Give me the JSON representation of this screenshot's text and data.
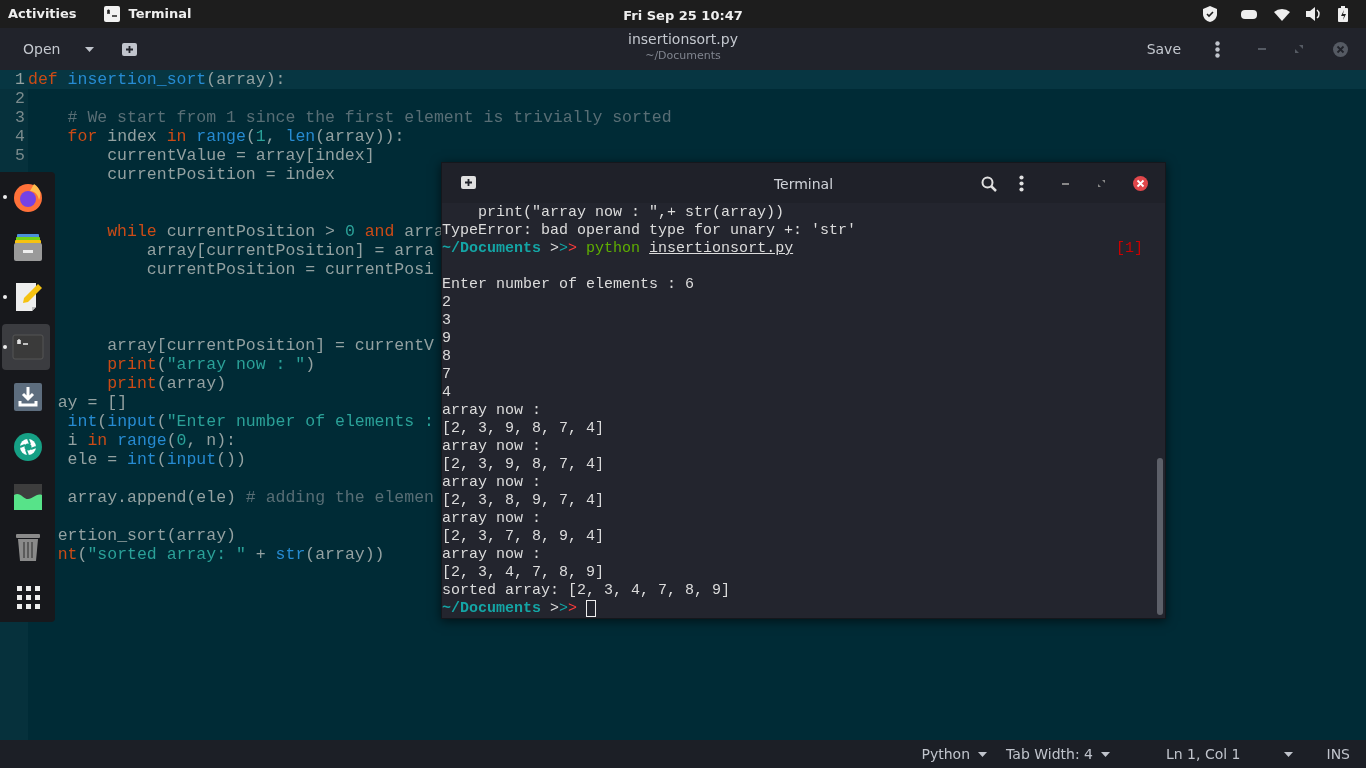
{
  "top_bar": {
    "activities": "Activities",
    "app_name": "Terminal",
    "clock": "Fri Sep 25  10:47"
  },
  "editor": {
    "open_label": "Open",
    "title": "insertionsort.py",
    "subtitle": "~/Documents",
    "save_label": "Save",
    "lines": [
      {
        "number": "1",
        "current": true,
        "tokens": [
          {
            "kind": "kw",
            "text": "def"
          },
          {
            "kind": "fn",
            "text": " insertion_sort"
          },
          {
            "kind": "plain",
            "text": "(array):"
          }
        ]
      },
      {
        "number": "2",
        "current": false
      },
      {
        "number": "3",
        "current": false,
        "tokens": [
          {
            "kind": "com",
            "text": "    # We start from 1 since the first element is trivially sorted"
          }
        ]
      },
      {
        "number": "4",
        "current": false,
        "tokens": [
          {
            "kind": "kw",
            "text": "    for"
          },
          {
            "kind": "plain",
            "text": " index "
          },
          {
            "kind": "kw",
            "text": "in"
          },
          {
            "kind": "fn",
            "text": " range"
          },
          {
            "kind": "plain",
            "text": "("
          },
          {
            "kind": "num",
            "text": "1"
          },
          {
            "kind": "plain",
            "text": ", "
          },
          {
            "kind": "fn",
            "text": "len"
          },
          {
            "kind": "plain",
            "text": "(array)):"
          }
        ]
      },
      {
        "number": "5",
        "current": false,
        "tokens": [
          {
            "kind": "plain",
            "text": "        currentValue = array[index]"
          }
        ]
      },
      {
        "current": false,
        "tokens": [
          {
            "kind": "plain",
            "text": "        currentPosition = index"
          }
        ]
      },
      {
        "current": false
      },
      {
        "current": false
      },
      {
        "current": false,
        "tokens": [
          {
            "kind": "kw",
            "text": "        while"
          },
          {
            "kind": "plain",
            "text": " currentPosition > "
          },
          {
            "kind": "num",
            "text": "0"
          },
          {
            "kind": "kw",
            "text": " and"
          },
          {
            "kind": "plain",
            "text": " arra"
          }
        ]
      },
      {
        "current": false,
        "tokens": [
          {
            "kind": "plain",
            "text": "            array[currentPosition] = arra"
          }
        ]
      },
      {
        "current": false,
        "tokens": [
          {
            "kind": "plain",
            "text": "            currentPosition = currentPosi"
          }
        ]
      },
      {
        "current": false
      },
      {
        "current": false
      },
      {
        "current": false
      },
      {
        "current": false,
        "tokens": [
          {
            "kind": "plain",
            "text": "        array[currentPosition] = currentV"
          }
        ]
      },
      {
        "current": false,
        "tokens": [
          {
            "kind": "kw",
            "text": "        print"
          },
          {
            "kind": "plain",
            "text": "("
          },
          {
            "kind": "str",
            "text": "\"array now : \""
          },
          {
            "kind": "plain",
            "text": ")"
          }
        ]
      },
      {
        "current": false,
        "tokens": [
          {
            "kind": "kw",
            "text": "        print"
          },
          {
            "kind": "plain",
            "text": "(array)"
          }
        ]
      },
      {
        "current": false,
        "tokens": [
          {
            "kind": "plain",
            "text": "   ay = []"
          }
        ]
      },
      {
        "current": false,
        "tokens": [
          {
            "kind": "fn",
            "text": "    int"
          },
          {
            "kind": "plain",
            "text": "("
          },
          {
            "kind": "fn",
            "text": "input"
          },
          {
            "kind": "plain",
            "text": "("
          },
          {
            "kind": "str",
            "text": "\"Enter number of elements :"
          }
        ]
      },
      {
        "current": false,
        "tokens": [
          {
            "kind": "plain",
            "text": "    i "
          },
          {
            "kind": "kw",
            "text": "in"
          },
          {
            "kind": "fn",
            "text": " range"
          },
          {
            "kind": "plain",
            "text": "("
          },
          {
            "kind": "num",
            "text": "0"
          },
          {
            "kind": "plain",
            "text": ", n):"
          }
        ]
      },
      {
        "current": false,
        "tokens": [
          {
            "kind": "plain",
            "text": "    ele = "
          },
          {
            "kind": "fn",
            "text": "int"
          },
          {
            "kind": "plain",
            "text": "("
          },
          {
            "kind": "fn",
            "text": "input"
          },
          {
            "kind": "plain",
            "text": "())"
          }
        ]
      },
      {
        "current": false
      },
      {
        "current": false,
        "tokens": [
          {
            "kind": "plain",
            "text": "    array.append(ele) "
          },
          {
            "kind": "com",
            "text": "# adding the elemen"
          }
        ]
      },
      {
        "current": false
      },
      {
        "current": false,
        "tokens": [
          {
            "kind": "plain",
            "text": "   ertion_sort(array)"
          }
        ]
      },
      {
        "current": false,
        "tokens": [
          {
            "kind": "kw",
            "text": "   nt"
          },
          {
            "kind": "plain",
            "text": "("
          },
          {
            "kind": "str",
            "text": "\"sorted array: \""
          },
          {
            "kind": "plain",
            "text": " + "
          },
          {
            "kind": "fn",
            "text": "str"
          },
          {
            "kind": "plain",
            "text": "(array))"
          }
        ]
      }
    ]
  },
  "status_bar": {
    "language": "Python",
    "tab_width": "Tab Width: 4",
    "position": "Ln 1, Col 1",
    "mode": "INS"
  },
  "dock": {
    "items": [
      {
        "kind": "browser",
        "running": true,
        "selected": false
      },
      {
        "kind": "files",
        "running": false,
        "selected": false
      },
      {
        "kind": "editor",
        "running": true,
        "selected": false
      },
      {
        "kind": "terminal",
        "running": true,
        "selected": true
      },
      {
        "kind": "download",
        "running": false,
        "selected": false
      },
      {
        "kind": "camera",
        "running": false,
        "selected": false
      },
      {
        "kind": "monitor",
        "running": false,
        "selected": false
      },
      {
        "kind": "trash",
        "running": false,
        "selected": false
      },
      {
        "kind": "apps",
        "running": false,
        "selected": false
      }
    ]
  },
  "terminal": {
    "title": "Terminal",
    "lines": [
      {
        "tokens": [
          {
            "kind": "plain",
            "text": "    print(\"array now : \",+ str(array))"
          }
        ]
      },
      {
        "tokens": [
          {
            "kind": "plain",
            "text": "TypeError: bad operand type for unary +: 'str'"
          }
        ]
      },
      {
        "tokens": [
          {
            "kind": "path",
            "text": "~/Documents"
          },
          {
            "kind": "plain",
            "text": " >"
          },
          {
            "kind": "teal",
            "text": ">"
          },
          {
            "kind": "red",
            "text": ">"
          },
          {
            "kind": "cmd",
            "text": " python"
          },
          {
            "kind": "file",
            "text": "insertionsort.py"
          }
        ],
        "status": "[1]"
      },
      {
        "kind": "blank"
      },
      {
        "tokens": [
          {
            "kind": "plain",
            "text": "Enter number of elements : 6"
          }
        ]
      },
      {
        "tokens": [
          {
            "kind": "plain",
            "text": "2"
          }
        ]
      },
      {
        "tokens": [
          {
            "kind": "plain",
            "text": "3"
          }
        ]
      },
      {
        "tokens": [
          {
            "kind": "plain",
            "text": "9"
          }
        ]
      },
      {
        "tokens": [
          {
            "kind": "plain",
            "text": "8"
          }
        ]
      },
      {
        "tokens": [
          {
            "kind": "plain",
            "text": "7"
          }
        ]
      },
      {
        "tokens": [
          {
            "kind": "plain",
            "text": "4"
          }
        ]
      },
      {
        "tokens": [
          {
            "kind": "plain",
            "text": "array now :"
          }
        ]
      },
      {
        "tokens": [
          {
            "kind": "plain",
            "text": "[2, 3, 9, 8, 7, 4]"
          }
        ]
      },
      {
        "tokens": [
          {
            "kind": "plain",
            "text": "array now :"
          }
        ]
      },
      {
        "tokens": [
          {
            "kind": "plain",
            "text": "[2, 3, 9, 8, 7, 4]"
          }
        ]
      },
      {
        "tokens": [
          {
            "kind": "plain",
            "text": "array now :"
          }
        ]
      },
      {
        "tokens": [
          {
            "kind": "plain",
            "text": "[2, 3, 8, 9, 7, 4]"
          }
        ]
      },
      {
        "tokens": [
          {
            "kind": "plain",
            "text": "array now :"
          }
        ]
      },
      {
        "tokens": [
          {
            "kind": "plain",
            "text": "[2, 3, 7, 8, 9, 4]"
          }
        ]
      },
      {
        "tokens": [
          {
            "kind": "plain",
            "text": "array now :"
          }
        ]
      },
      {
        "tokens": [
          {
            "kind": "plain",
            "text": "[2, 3, 4, 7, 8, 9]"
          }
        ]
      },
      {
        "tokens": [
          {
            "kind": "plain",
            "text": "sorted array: [2, 3, 4, 7, 8, 9]"
          }
        ]
      },
      {
        "tokens": [
          {
            "kind": "path",
            "text": "~/Documents"
          },
          {
            "kind": "plain",
            "text": " >"
          },
          {
            "kind": "teal",
            "text": ">"
          },
          {
            "kind": "red",
            "text": ">"
          }
        ],
        "cursor": true
      }
    ]
  }
}
